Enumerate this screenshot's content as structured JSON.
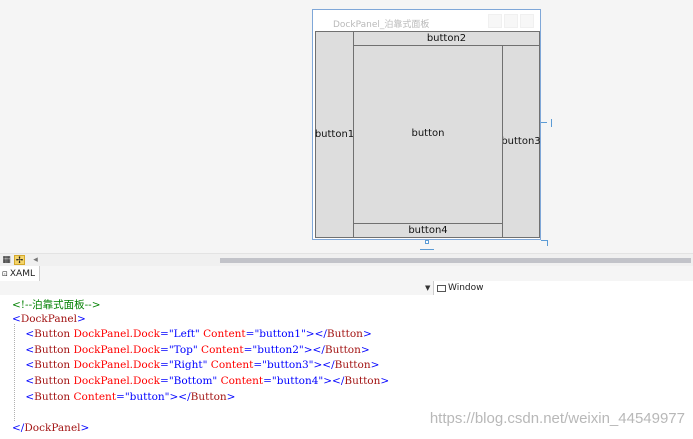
{
  "designer": {
    "window_title": "DockPanel_泊靠式面板",
    "buttons": {
      "left": "button1",
      "top": "button2",
      "right": "button3",
      "bottom": "button4",
      "fill": "button"
    }
  },
  "tabs": [
    {
      "label": "XAML",
      "icon": "xaml-icon"
    }
  ],
  "nav": {
    "dropdown_icon": "chevron-down-icon",
    "element_icon": "window-element-icon",
    "element_label": "Window"
  },
  "code_lines": [
    [
      {
        "t": "<!--泊靠式面板-->",
        "c": "c-com"
      }
    ],
    [
      {
        "t": "<",
        "c": "c-br"
      },
      {
        "t": "DockPanel",
        "c": "c-el"
      },
      {
        "t": ">",
        "c": "c-br"
      }
    ],
    [
      {
        "t": "    <",
        "c": "c-br"
      },
      {
        "t": "Button",
        "c": "c-el"
      },
      {
        "t": " DockPanel.Dock",
        "c": "c-at"
      },
      {
        "t": "=\"Left\"",
        "c": "c-val"
      },
      {
        "t": " Content",
        "c": "c-at"
      },
      {
        "t": "=\"button1\"></",
        "c": "c-val"
      },
      {
        "t": "Button",
        "c": "c-el"
      },
      {
        "t": ">",
        "c": "c-br"
      }
    ],
    [
      {
        "t": "    <",
        "c": "c-br"
      },
      {
        "t": "Button",
        "c": "c-el"
      },
      {
        "t": " DockPanel.Dock",
        "c": "c-at"
      },
      {
        "t": "=\"Top\"",
        "c": "c-val"
      },
      {
        "t": " Content",
        "c": "c-at"
      },
      {
        "t": "=\"button2\"></",
        "c": "c-val"
      },
      {
        "t": "Button",
        "c": "c-el"
      },
      {
        "t": ">",
        "c": "c-br"
      }
    ],
    [
      {
        "t": "    <",
        "c": "c-br"
      },
      {
        "t": "Button",
        "c": "c-el"
      },
      {
        "t": " DockPanel.Dock",
        "c": "c-at"
      },
      {
        "t": "=\"Right\"",
        "c": "c-val"
      },
      {
        "t": " Content",
        "c": "c-at"
      },
      {
        "t": "=\"button3\"></",
        "c": "c-val"
      },
      {
        "t": "Button",
        "c": "c-el"
      },
      {
        "t": ">",
        "c": "c-br"
      }
    ],
    [
      {
        "t": "    <",
        "c": "c-br"
      },
      {
        "t": "Button",
        "c": "c-el"
      },
      {
        "t": " DockPanel.Dock",
        "c": "c-at"
      },
      {
        "t": "=\"Bottom\"",
        "c": "c-val"
      },
      {
        "t": " Content",
        "c": "c-at"
      },
      {
        "t": "=\"button4\"></",
        "c": "c-val"
      },
      {
        "t": "Button",
        "c": "c-el"
      },
      {
        "t": ">",
        "c": "c-br"
      }
    ],
    [
      {
        "t": "    <",
        "c": "c-br"
      },
      {
        "t": "Button",
        "c": "c-el"
      },
      {
        "t": " Content",
        "c": "c-at"
      },
      {
        "t": "=\"button\"></",
        "c": "c-val"
      },
      {
        "t": "Button",
        "c": "c-el"
      },
      {
        "t": ">",
        "c": "c-br"
      }
    ],
    [],
    [
      {
        "t": "</",
        "c": "c-br"
      },
      {
        "t": "DockPanel",
        "c": "c-el"
      },
      {
        "t": ">",
        "c": "c-br"
      }
    ]
  ],
  "watermark": "https://blog.csdn.net/weixin_44549977",
  "colors": {
    "selection": "#5b9bd5",
    "button_face": "#dddddd",
    "comment": "#008000",
    "element": "#a31515",
    "attribute": "#ff0000",
    "value": "#0000ff"
  }
}
